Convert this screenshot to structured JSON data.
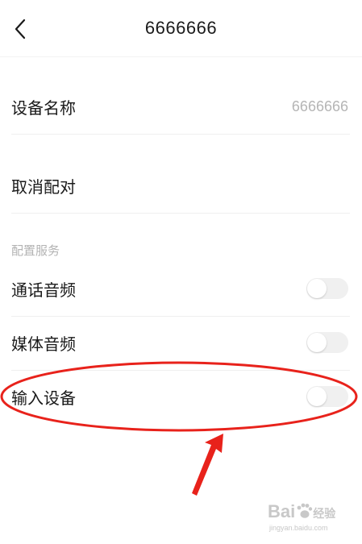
{
  "header": {
    "title": "6666666"
  },
  "rows": {
    "device_name": {
      "label": "设备名称",
      "value": "6666666"
    },
    "unpair": {
      "label": "取消配对"
    }
  },
  "services": {
    "section_label": "配置服务",
    "items": [
      {
        "label": "通话音频",
        "enabled": false
      },
      {
        "label": "媒体音频",
        "enabled": false
      },
      {
        "label": "输入设备",
        "enabled": false
      }
    ]
  },
  "watermark": {
    "brand": "Bai",
    "brand_suffix": "经验",
    "url": "jingyan.baidu.com"
  },
  "colors": {
    "annotation": "#e8221b",
    "toggle_track": "#f0f0f0",
    "secondary_text": "#b5b5b5"
  },
  "icons": {
    "back": "chevron-left-icon",
    "watermark_logo": "paw-icon"
  }
}
